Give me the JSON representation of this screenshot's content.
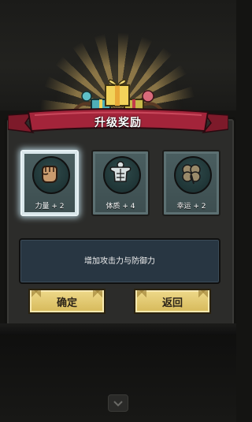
{
  "title": "升级奖励",
  "options": [
    {
      "icon": "fist-icon",
      "label": "力量 + 2",
      "selected": true
    },
    {
      "icon": "muscle-body-icon",
      "label": "体质 + 4",
      "selected": false
    },
    {
      "icon": "clover-icon",
      "label": "幸运 + 2",
      "selected": false
    }
  ],
  "description": "增加攻击力与防御力",
  "buttons": {
    "confirm": "确定",
    "back": "返回"
  },
  "colors": {
    "ribbon": "#a3243a",
    "card": "#4a5e60",
    "button": "#e3c773",
    "description_bg": "#283642"
  }
}
